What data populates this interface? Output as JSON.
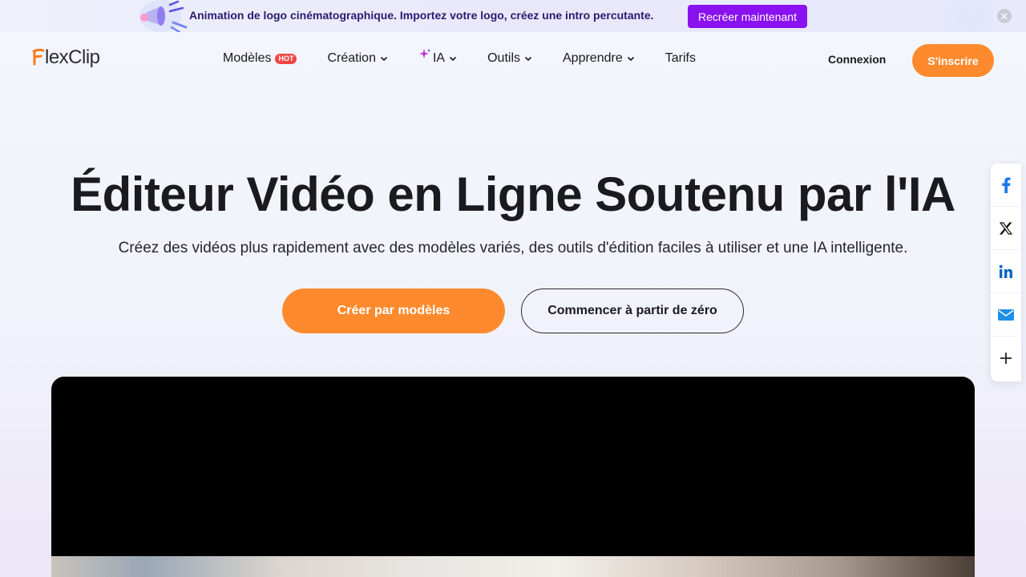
{
  "promo": {
    "text": "Animation de logo cinématographique. Importez votre logo, créez une intro percutante.",
    "cta": "Recréer maintenant",
    "close_icon": "close-icon",
    "art_icon": "megaphone-icon"
  },
  "header": {
    "logo": "FlexClip",
    "nav": {
      "models": "Modèles",
      "models_badge": "HOT",
      "creation": "Création",
      "ai": "IA",
      "tools": "Outils",
      "learn": "Apprendre",
      "pricing": "Tarifs"
    },
    "login": "Connexion",
    "signup": "S'inscrire"
  },
  "hero": {
    "title": "Éditeur Vidéo en Ligne Soutenu par l'IA",
    "subtitle": "Créez des vidéos plus rapidement avec des modèles variés, des outils d'édition faciles à utiliser et une IA intelligente.",
    "primary_cta": "Créer par modèles",
    "secondary_cta": "Commencer à partir de zéro"
  },
  "share": {
    "items": [
      "facebook-icon",
      "x-icon",
      "linkedin-icon",
      "email-icon",
      "plus-icon"
    ]
  },
  "colors": {
    "accent_orange": "#ff8a2e",
    "promo_purple": "#8a12f0",
    "hot_red": "#f04646",
    "facebook_blue": "#1877f2",
    "linkedin_blue": "#0a66c2"
  }
}
